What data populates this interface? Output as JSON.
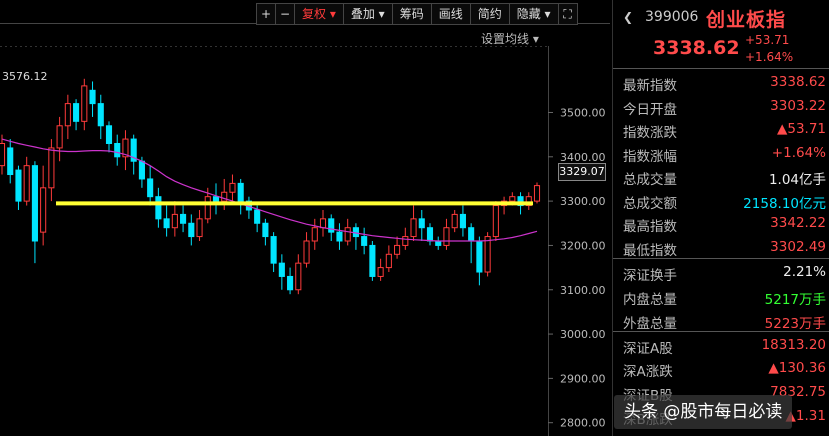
{
  "toolbar": {
    "plus": "+",
    "minus": "−",
    "restore_rights": "复权 ▾",
    "overlay": "叠加 ▾",
    "chips": "筹码",
    "drawing": "画线",
    "brief": "简约",
    "hide": "隐藏 ▾",
    "fullscreen": "⛶"
  },
  "ma_settings_label": "设置均线 ▾",
  "colors": {
    "up": "#ff3b3b",
    "down": "#00e5ff",
    "ma": "#cc33cc",
    "support_line": "#ffff33"
  },
  "chart_data": {
    "type": "candlestick",
    "peak_label": "3576.12",
    "current_price_label": "3329.07",
    "support_level": 3295,
    "ylim": [
      2770,
      3650
    ],
    "y_ticks": [
      "3500.00",
      "3400.00",
      "3300.00",
      "3200.00",
      "3100.00",
      "3000.00",
      "2900.00",
      "2800.00"
    ],
    "y_tick_values": [
      3500,
      3400,
      3300,
      3200,
      3100,
      3000,
      2900,
      2800
    ],
    "candles": [
      [
        3380,
        3430,
        3360,
        3450
      ],
      [
        3420,
        3360,
        3340,
        3440
      ],
      [
        3370,
        3300,
        3280,
        3380
      ],
      [
        3300,
        3380,
        3290,
        3400
      ],
      [
        3380,
        3210,
        3160,
        3390
      ],
      [
        3230,
        3330,
        3200,
        3380
      ],
      [
        3330,
        3420,
        3300,
        3440
      ],
      [
        3420,
        3470,
        3390,
        3490
      ],
      [
        3470,
        3520,
        3440,
        3540
      ],
      [
        3520,
        3480,
        3460,
        3530
      ],
      [
        3480,
        3560,
        3460,
        3576
      ],
      [
        3550,
        3520,
        3490,
        3570
      ],
      [
        3520,
        3470,
        3440,
        3540
      ],
      [
        3470,
        3430,
        3410,
        3480
      ],
      [
        3430,
        3400,
        3380,
        3450
      ],
      [
        3400,
        3440,
        3370,
        3460
      ],
      [
        3440,
        3390,
        3360,
        3450
      ],
      [
        3390,
        3350,
        3330,
        3400
      ],
      [
        3350,
        3310,
        3290,
        3380
      ],
      [
        3310,
        3260,
        3240,
        3330
      ],
      [
        3260,
        3240,
        3220,
        3290
      ],
      [
        3240,
        3270,
        3220,
        3300
      ],
      [
        3270,
        3250,
        3230,
        3290
      ],
      [
        3250,
        3220,
        3200,
        3270
      ],
      [
        3220,
        3260,
        3210,
        3280
      ],
      [
        3260,
        3310,
        3250,
        3330
      ],
      [
        3310,
        3300,
        3270,
        3340
      ],
      [
        3300,
        3320,
        3280,
        3350
      ],
      [
        3320,
        3340,
        3300,
        3360
      ],
      [
        3340,
        3300,
        3270,
        3350
      ],
      [
        3300,
        3280,
        3260,
        3310
      ],
      [
        3280,
        3250,
        3230,
        3290
      ],
      [
        3250,
        3220,
        3200,
        3260
      ],
      [
        3220,
        3160,
        3140,
        3230
      ],
      [
        3160,
        3130,
        3100,
        3180
      ],
      [
        3130,
        3100,
        3090,
        3150
      ],
      [
        3100,
        3160,
        3090,
        3180
      ],
      [
        3160,
        3210,
        3150,
        3230
      ],
      [
        3210,
        3240,
        3190,
        3260
      ],
      [
        3240,
        3260,
        3220,
        3280
      ],
      [
        3260,
        3230,
        3210,
        3270
      ],
      [
        3230,
        3210,
        3190,
        3250
      ],
      [
        3210,
        3240,
        3200,
        3260
      ],
      [
        3240,
        3220,
        3190,
        3250
      ],
      [
        3220,
        3200,
        3180,
        3240
      ],
      [
        3200,
        3130,
        3120,
        3210
      ],
      [
        3130,
        3150,
        3120,
        3170
      ],
      [
        3150,
        3180,
        3140,
        3200
      ],
      [
        3180,
        3200,
        3170,
        3220
      ],
      [
        3200,
        3220,
        3190,
        3240
      ],
      [
        3220,
        3260,
        3210,
        3290
      ],
      [
        3260,
        3240,
        3210,
        3280
      ],
      [
        3240,
        3210,
        3200,
        3250
      ],
      [
        3210,
        3200,
        3190,
        3220
      ],
      [
        3200,
        3240,
        3190,
        3260
      ],
      [
        3240,
        3270,
        3230,
        3280
      ],
      [
        3270,
        3240,
        3220,
        3290
      ],
      [
        3240,
        3210,
        3160,
        3250
      ],
      [
        3210,
        3140,
        3110,
        3220
      ],
      [
        3140,
        3220,
        3130,
        3230
      ],
      [
        3220,
        3290,
        3210,
        3300
      ],
      [
        3290,
        3300,
        3270,
        3310
      ],
      [
        3300,
        3310,
        3290,
        3320
      ],
      [
        3310,
        3290,
        3270,
        3320
      ],
      [
        3290,
        3310,
        3280,
        3320
      ],
      [
        3300,
        3335,
        3295,
        3342
      ]
    ],
    "ma": [
      3440,
      3435,
      3430,
      3426,
      3422,
      3418,
      3415,
      3413,
      3412,
      3412,
      3413,
      3414,
      3414,
      3413,
      3410,
      3405,
      3398,
      3390,
      3380,
      3368,
      3355,
      3345,
      3337,
      3330,
      3324,
      3318,
      3312,
      3306,
      3300,
      3294,
      3288,
      3282,
      3276,
      3270,
      3264,
      3258,
      3253,
      3248,
      3244,
      3240,
      3237,
      3234,
      3231,
      3228,
      3225,
      3222,
      3220,
      3218,
      3216,
      3214,
      3213,
      3212,
      3211,
      3210,
      3210,
      3210,
      3210,
      3210,
      3210,
      3211,
      3213,
      3215,
      3218,
      3222,
      3227,
      3232
    ]
  },
  "panel": {
    "arrow": "❮",
    "code": "399006",
    "name": "创业板指",
    "price": "3338.62",
    "change": "+53.71",
    "change_pct": "+1.64%",
    "rows": [
      {
        "label": "最新指数",
        "value": "3338.62",
        "color": "#ff4b4b"
      },
      {
        "label": "今日开盘",
        "value": "3303.22",
        "color": "#ff4b4b"
      },
      {
        "label": "指数涨跌",
        "value": "▲53.71",
        "color": "#ff4b4b"
      },
      {
        "label": "指数涨幅",
        "value": "+1.64%",
        "color": "#ff4b4b"
      },
      {
        "label": "总成交量",
        "value": "1.04亿手",
        "color": "#eeeeee"
      },
      {
        "label": "总成交额",
        "value": "2158.10亿元",
        "color": "#00e5ff"
      },
      {
        "label": "最高指数",
        "value": "3342.22",
        "color": "#ff4b4b"
      },
      {
        "label": "最低指数",
        "value": "3302.49",
        "color": "#ff4b4b"
      },
      {
        "label": "深证换手",
        "value": "2.21%",
        "color": "#eeeeee"
      },
      {
        "label": "内盘总量",
        "value": "5217万手",
        "color": "#33ff33"
      },
      {
        "label": "外盘总量",
        "value": "5223万手",
        "color": "#ff4b4b"
      },
      {
        "label": "深证A股",
        "value": "18313.20",
        "color": "#ff4b4b"
      },
      {
        "label": "深A涨跌",
        "value": "▲130.36",
        "color": "#ff4b4b"
      },
      {
        "label": "深证B股",
        "value": "7832.75",
        "color": "#ff4b4b"
      },
      {
        "label": "深B涨跌",
        "value": "▲1.31",
        "color": "#ff4b4b"
      }
    ]
  },
  "watermark": "头条 @股市每日必读"
}
